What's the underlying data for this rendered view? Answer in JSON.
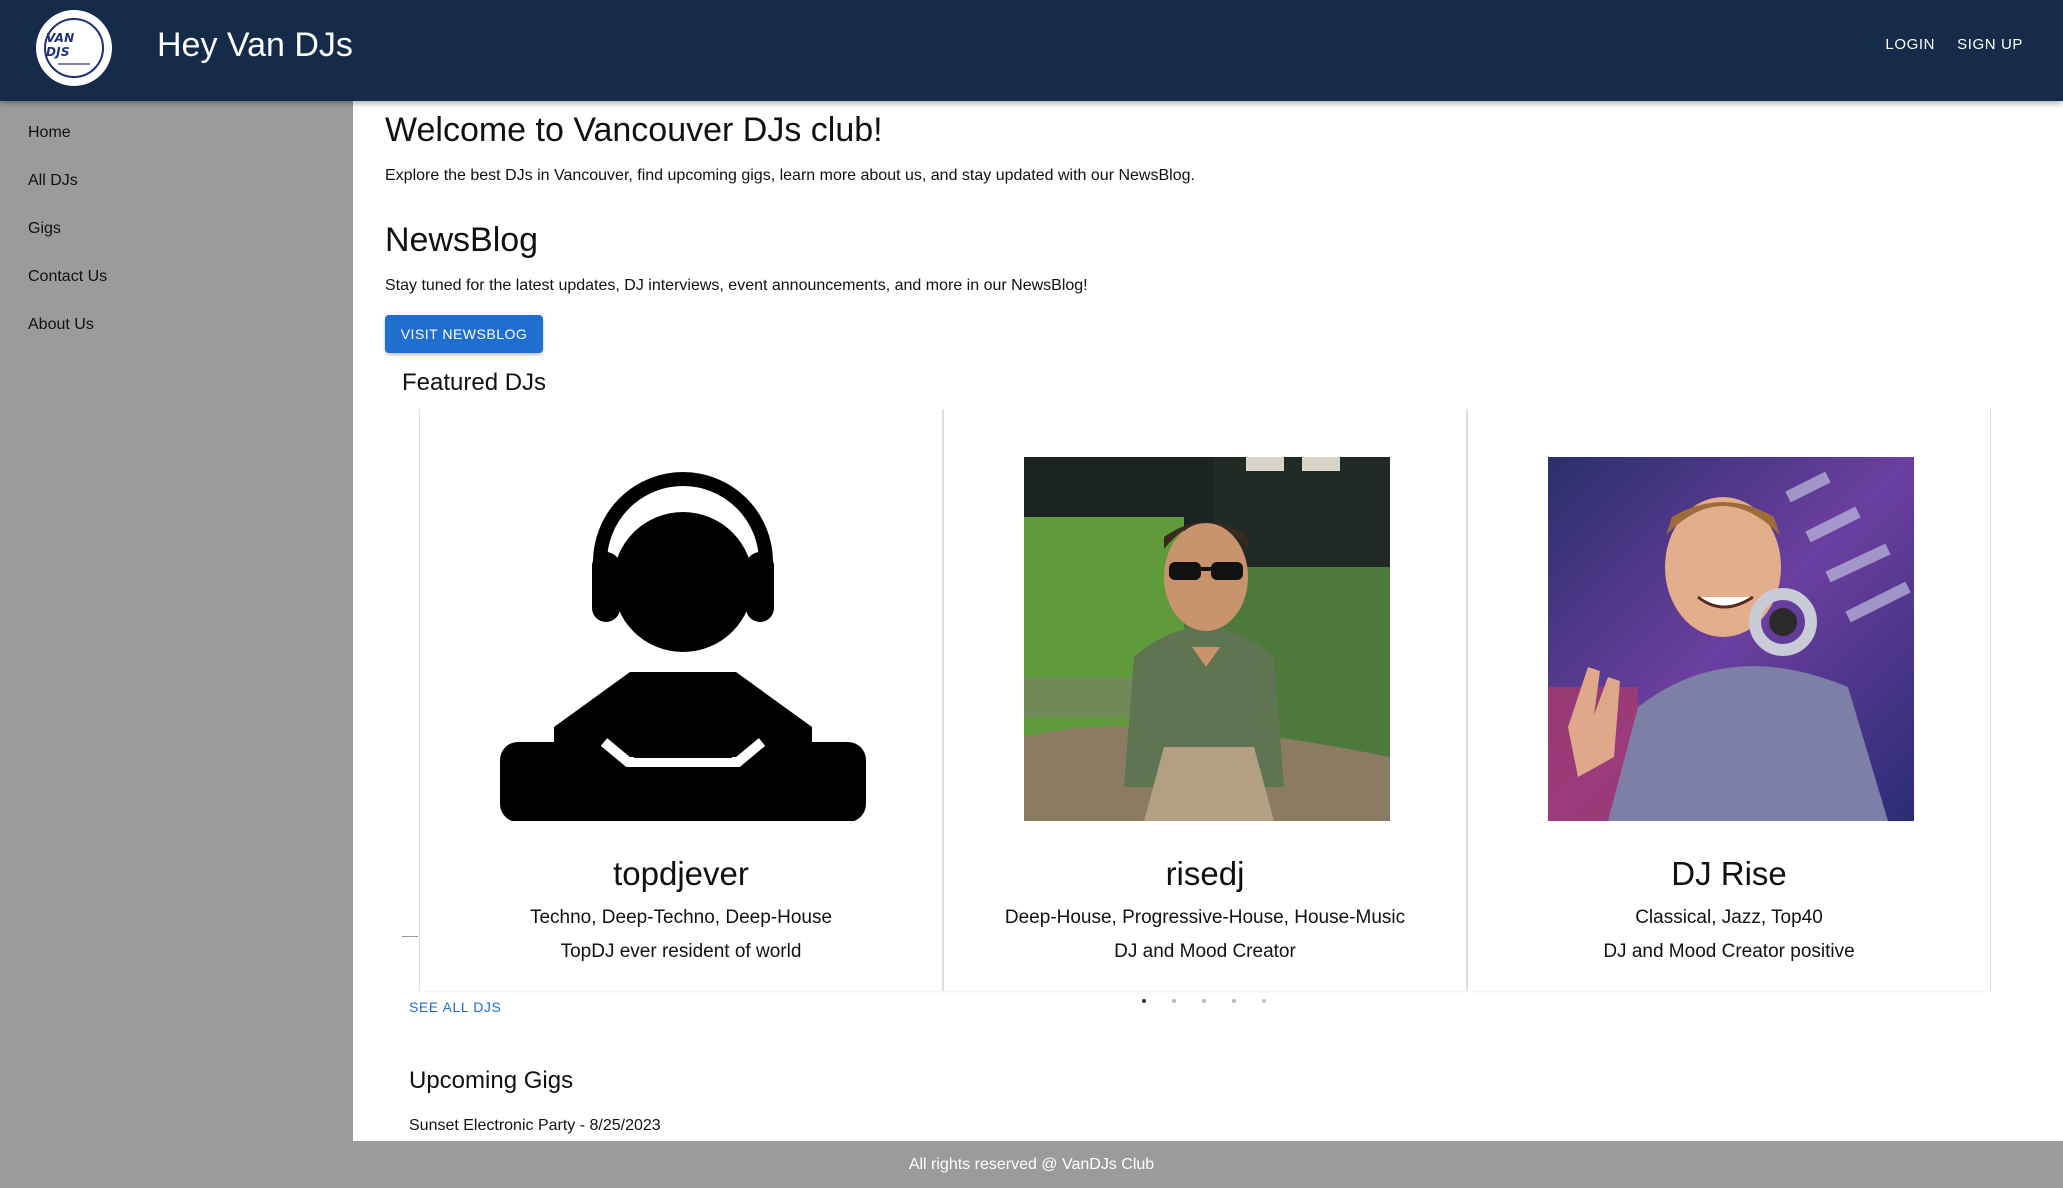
{
  "header": {
    "logo_text": "VAN DJS",
    "title": "Hey Van DJs",
    "login_label": "LOGIN",
    "signup_label": "SIGN UP"
  },
  "sidebar": {
    "items": [
      {
        "label": "Home"
      },
      {
        "label": "All DJs"
      },
      {
        "label": "Gigs"
      },
      {
        "label": "Contact Us"
      },
      {
        "label": "About Us"
      }
    ]
  },
  "main": {
    "welcome_title": "Welcome to Vancouver DJs club!",
    "welcome_text": "Explore the best DJs in Vancouver, find upcoming gigs, learn more about us, and stay updated with our NewsBlog.",
    "news_title": "NewsBlog",
    "news_text": "Stay tuned for the latest updates, DJ interviews, event announcements, and more in our NewsBlog!",
    "news_button": "VISIT NEWSBLOG",
    "featured_title": "Featured DJs",
    "djs": [
      {
        "name": "topdjever",
        "genres": "Techno, Deep-Techno, Deep-House",
        "description": "TopDJ ever resident of world",
        "image": "dj-silhouette-icon"
      },
      {
        "name": "risedj",
        "genres": "Deep-House, Progressive-House, House-Music",
        "description": "DJ and Mood Creator",
        "image": "dj-photo-outdoor"
      },
      {
        "name": "DJ Rise",
        "genres": "Classical, Jazz, Top40",
        "description": "DJ and Mood Creator positive",
        "image": "dj-photo-headphones"
      }
    ],
    "see_all_label": "SEE ALL DJS",
    "carousel": {
      "active_page": 1,
      "total_pages": 5
    },
    "gigs_title": "Upcoming Gigs",
    "gigs": [
      {
        "text": "Sunset Electronic Party - 8/25/2023"
      }
    ]
  },
  "footer": {
    "text": "All rights reserved @ VanDJs Club"
  },
  "colors": {
    "header_bg": "#152b4a",
    "sidebar_bg": "#9b9b9b",
    "accent": "#1f6fd1"
  }
}
